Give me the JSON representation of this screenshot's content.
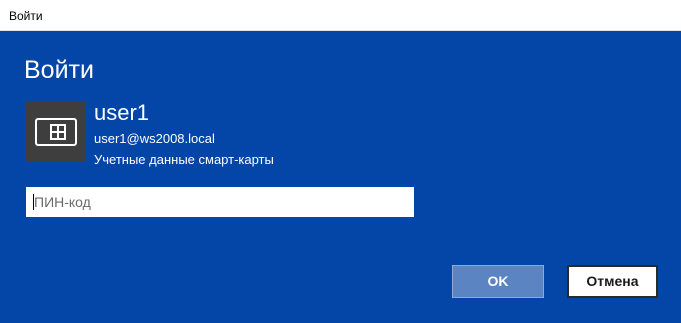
{
  "window": {
    "title": "Войти"
  },
  "dialog": {
    "heading": "Войти"
  },
  "user": {
    "name": "user1",
    "email": "user1@ws2008.local",
    "credential_type": "Учетные данные смарт-карты",
    "icon": "smart-card-icon"
  },
  "pin": {
    "value": "",
    "placeholder": "ПИН-код"
  },
  "buttons": {
    "ok_label": "OK",
    "cancel_label": "Отмена"
  },
  "colors": {
    "background": "#0346a8",
    "tile": "#3e3e3e",
    "ok_button": "#5b84c2"
  }
}
